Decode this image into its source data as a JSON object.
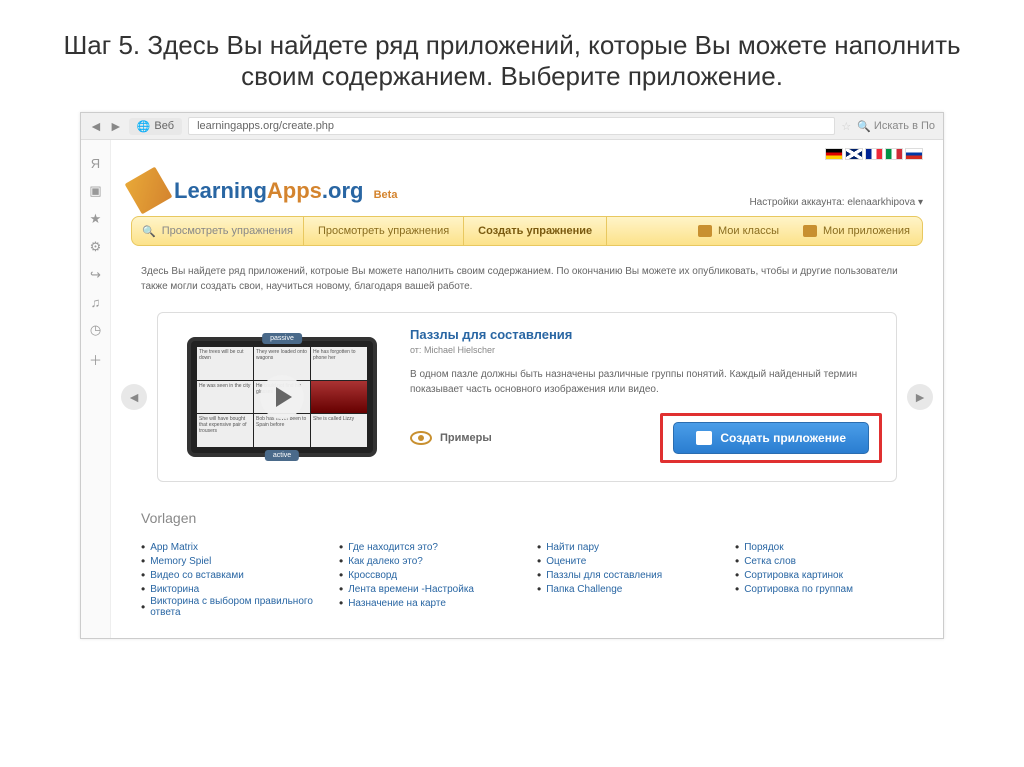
{
  "slide": {
    "title": "Шаг 5. Здесь Вы найдете ряд приложений, которые Вы можете наполнить своим содержанием. Выберите приложение."
  },
  "browser": {
    "web_label": "Веб",
    "url": "learningapps.org/create.php",
    "search_placeholder": "Искать в По"
  },
  "logo": {
    "learn": "Learning",
    "apps": "Apps",
    "org": ".org",
    "beta": "Beta"
  },
  "account": {
    "label": "Настройки аккаунта: elenaarkhipova"
  },
  "menu": {
    "search_placeholder": "Просмотреть упражнения",
    "browse": "Просмотреть упражнения",
    "create": "Создать упражнение",
    "classes": "Мои классы",
    "apps": "Мои приложения"
  },
  "intro": "Здесь Вы найдете ряд приложений, котроые Вы можете наполнить своим содержанием. По окончанию Вы можете их опубликовать, чтобы и другие пользователи также могли создать свои, научиться новому, благодаря вашей работе.",
  "preview": {
    "tab_top": "passive",
    "tab_bottom": "active",
    "title": "Паззлы для составления",
    "author_prefix": "от:",
    "author": "Michael Hielscher",
    "desc": "В одном пазле должны быть назначены различные группы понятий. Каждый найденный термин показывает часть основного изображения или видео.",
    "examples": "Примеры",
    "create_button": "Создать приложение"
  },
  "vorlagen": {
    "title": "Vorlagen",
    "col1": [
      "App Matrix",
      "Memory Spiel",
      "Видео со вставками",
      "Викторина",
      "Викторина с выбором правильного ответа"
    ],
    "col2": [
      "Где находится это?",
      "Как далеко это?",
      "Кроссворд",
      "Лента времени -Настройка",
      "Назначение на карте"
    ],
    "col3": [
      "Найти пару",
      "Оцените",
      "Паззлы для составления",
      "Папка Challenge"
    ],
    "col4": [
      "Порядок",
      "Сетка слов",
      "Сортировка картинок",
      "Сортировка по группам"
    ]
  }
}
